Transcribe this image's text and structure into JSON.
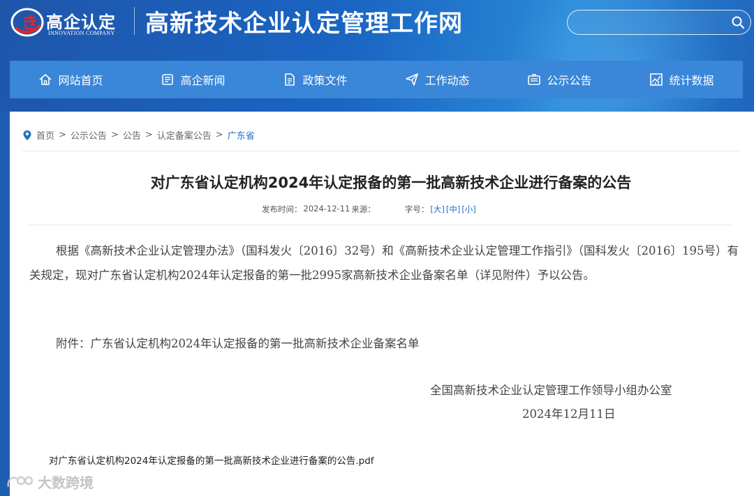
{
  "header": {
    "logo_text": "高企认定",
    "logo_subtext": "INNOVATION COMPANY",
    "site_title": "高新技术企业认定管理工作网",
    "search_placeholder": ""
  },
  "nav": [
    {
      "label": "网站首页",
      "icon": "home-icon"
    },
    {
      "label": "高企新闻",
      "icon": "news-icon"
    },
    {
      "label": "政策文件",
      "icon": "document-icon"
    },
    {
      "label": "工作动态",
      "icon": "send-icon"
    },
    {
      "label": "公示公告",
      "icon": "notice-icon"
    },
    {
      "label": "统计数据",
      "icon": "chart-icon"
    }
  ],
  "breadcrumb": {
    "items": [
      "首页",
      "公示公告",
      "公告",
      "认定备案公告"
    ],
    "current": "广东省",
    "separator": ">"
  },
  "article": {
    "title": "对广东省认定机构2024年认定报备的第一批高新技术企业进行备案的公告",
    "publish_label": "发布时间：",
    "publish_date": "2024-12-11",
    "source_label": "来源：",
    "font_size_label": "字号：",
    "size_large": "[大]",
    "size_medium": "[中]",
    "size_small": "[小]",
    "body": "根据《高新技术企业认定管理办法》（国科发火〔2016〕32号）和《高新技术企业认定管理工作指引》（国科发火〔2016〕195号）有关规定，现对广东省认定机构2024年认定报备的第一批2995家高新技术企业备案名单（详见附件）予以公告。",
    "attachment": "附件：广东省认定机构2024年认定报备的第一批高新技术企业备案名单",
    "signature_org": "全国高新技术企业认定管理工作领导小组办公室",
    "signature_date": "2024年12月11日",
    "pdf_link": "对广东省认定机构2024年认定报备的第一批高新技术企业进行备案的公告.pdf"
  },
  "watermark": "大数跨境",
  "colors": {
    "header_bg": "#1e5fb6",
    "nav_bg": "#3a86d8",
    "link_blue": "#1f6fc5",
    "logo_red": "#e0262a"
  }
}
